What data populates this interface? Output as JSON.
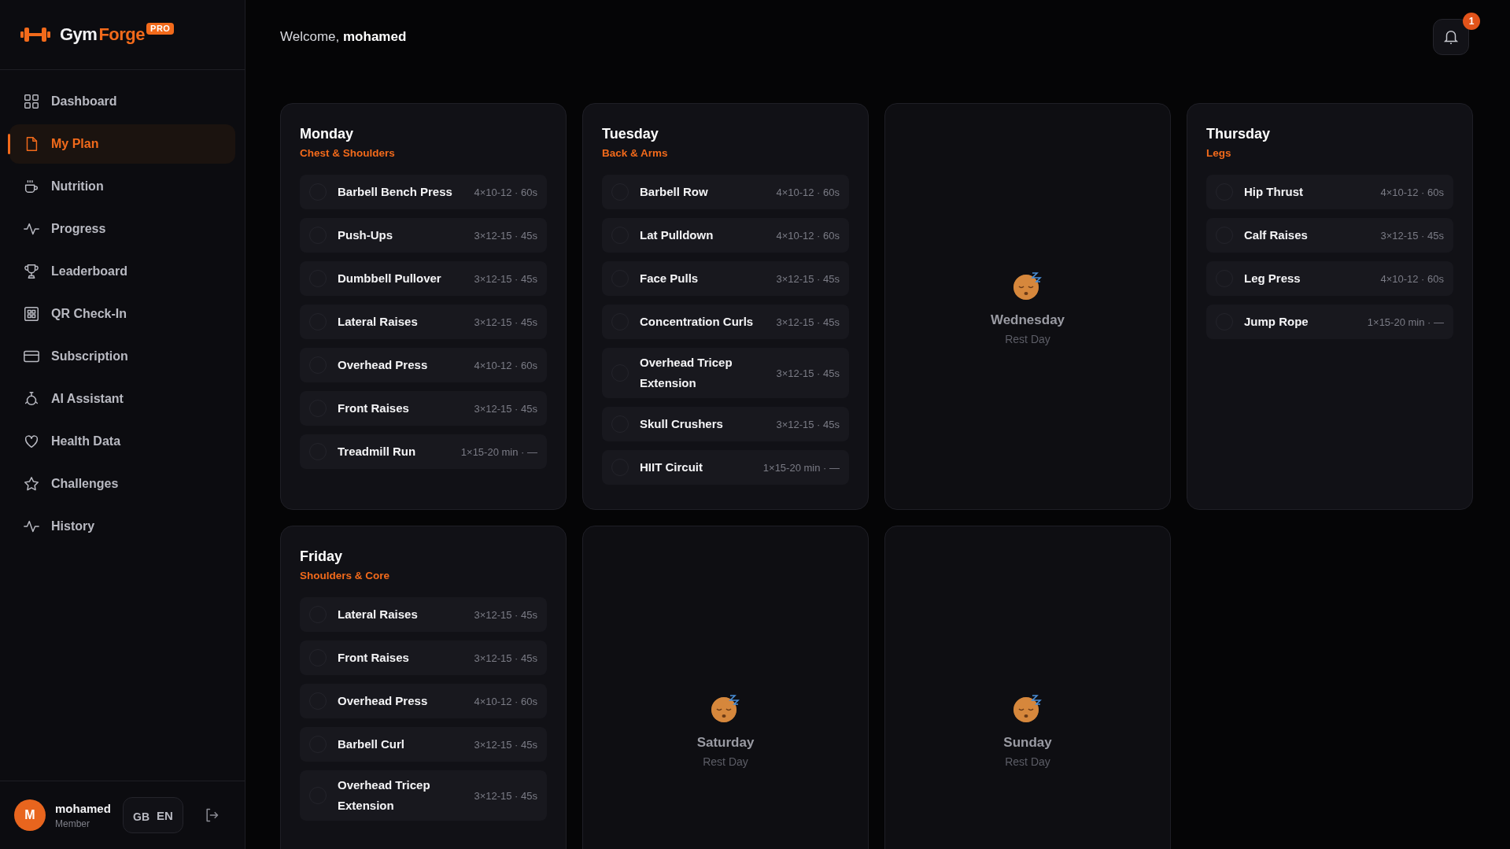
{
  "brand": {
    "name_first": "Gym",
    "name_second": "Forge",
    "badge": "PRO"
  },
  "sidebar": {
    "items": [
      {
        "label": "Dashboard",
        "selected": false
      },
      {
        "label": "My Plan",
        "selected": true
      },
      {
        "label": "Nutrition",
        "selected": false
      },
      {
        "label": "Progress",
        "selected": false
      },
      {
        "label": "Leaderboard",
        "selected": false
      },
      {
        "label": "QR Check-In",
        "selected": false
      },
      {
        "label": "Subscription",
        "selected": false
      },
      {
        "label": "AI Assistant",
        "selected": false
      },
      {
        "label": "Health Data",
        "selected": false
      },
      {
        "label": "Challenges",
        "selected": false
      },
      {
        "label": "History",
        "selected": false
      }
    ]
  },
  "user": {
    "initial": "M",
    "name": "mohamed",
    "role": "Member",
    "language": {
      "flag": "GB",
      "code": "EN"
    }
  },
  "header": {
    "welcome": "Welcome,",
    "user": "mohamed",
    "notifications": "1"
  },
  "days": [
    {
      "kind": "workout",
      "day": "Monday",
      "focus": "Chest & Shoulders",
      "exercises": [
        {
          "name": "Barbell Bench Press",
          "scheme": "4×10-12 · 60s",
          "done": false
        },
        {
          "name": "Push-Ups",
          "scheme": "3×12-15 · 45s",
          "done": false
        },
        {
          "name": "Dumbbell Pullover",
          "scheme": "3×12-15 · 45s",
          "done": false
        },
        {
          "name": "Lateral Raises",
          "scheme": "3×12-15 · 45s",
          "done": false
        },
        {
          "name": "Overhead Press",
          "scheme": "4×10-12 · 60s",
          "done": false
        },
        {
          "name": "Front Raises",
          "scheme": "3×12-15 · 45s",
          "done": false
        },
        {
          "name": "Treadmill Run",
          "scheme": "1×15-20 min · —",
          "done": false
        }
      ]
    },
    {
      "kind": "workout",
      "day": "Tuesday",
      "focus": "Back & Arms",
      "exercises": [
        {
          "name": "Barbell Row",
          "scheme": "4×10-12 · 60s",
          "done": false
        },
        {
          "name": "Lat Pulldown",
          "scheme": "4×10-12 · 60s",
          "done": false
        },
        {
          "name": "Face Pulls",
          "scheme": "3×12-15 · 45s",
          "done": false
        },
        {
          "name": "Concentration Curls",
          "scheme": "3×12-15 · 45s",
          "done": false
        },
        {
          "name": "Overhead Tricep Extension",
          "scheme": "3×12-15 · 45s",
          "done": false
        },
        {
          "name": "Skull Crushers",
          "scheme": "3×12-15 · 45s",
          "done": false
        },
        {
          "name": "HIIT Circuit",
          "scheme": "1×15-20 min · —",
          "done": false
        }
      ]
    },
    {
      "kind": "rest",
      "day": "Wednesday",
      "label": "Rest Day"
    },
    {
      "kind": "workout",
      "day": "Thursday",
      "focus": "Legs",
      "exercises": [
        {
          "name": "Hip Thrust",
          "scheme": "4×10-12 · 60s",
          "done": false
        },
        {
          "name": "Calf Raises",
          "scheme": "3×12-15 · 45s",
          "done": false
        },
        {
          "name": "Leg Press",
          "scheme": "4×10-12 · 60s",
          "done": false
        },
        {
          "name": "Jump Rope",
          "scheme": "1×15-20 min · —",
          "done": false
        }
      ]
    },
    {
      "kind": "workout",
      "day": "Friday",
      "focus": "Shoulders & Core",
      "exercises": [
        {
          "name": "Lateral Raises",
          "scheme": "3×12-15 · 45s",
          "done": false
        },
        {
          "name": "Front Raises",
          "scheme": "3×12-15 · 45s",
          "done": false
        },
        {
          "name": "Overhead Press",
          "scheme": "4×10-12 · 60s",
          "done": false
        },
        {
          "name": "Barbell Curl",
          "scheme": "3×12-15 · 45s",
          "done": false
        },
        {
          "name": "Overhead Tricep Extension",
          "scheme": "3×12-15 · 45s",
          "done": false
        }
      ]
    },
    {
      "kind": "rest",
      "day": "Saturday",
      "label": "Rest Day"
    },
    {
      "kind": "rest",
      "day": "Sunday",
      "label": "Rest Day"
    }
  ]
}
